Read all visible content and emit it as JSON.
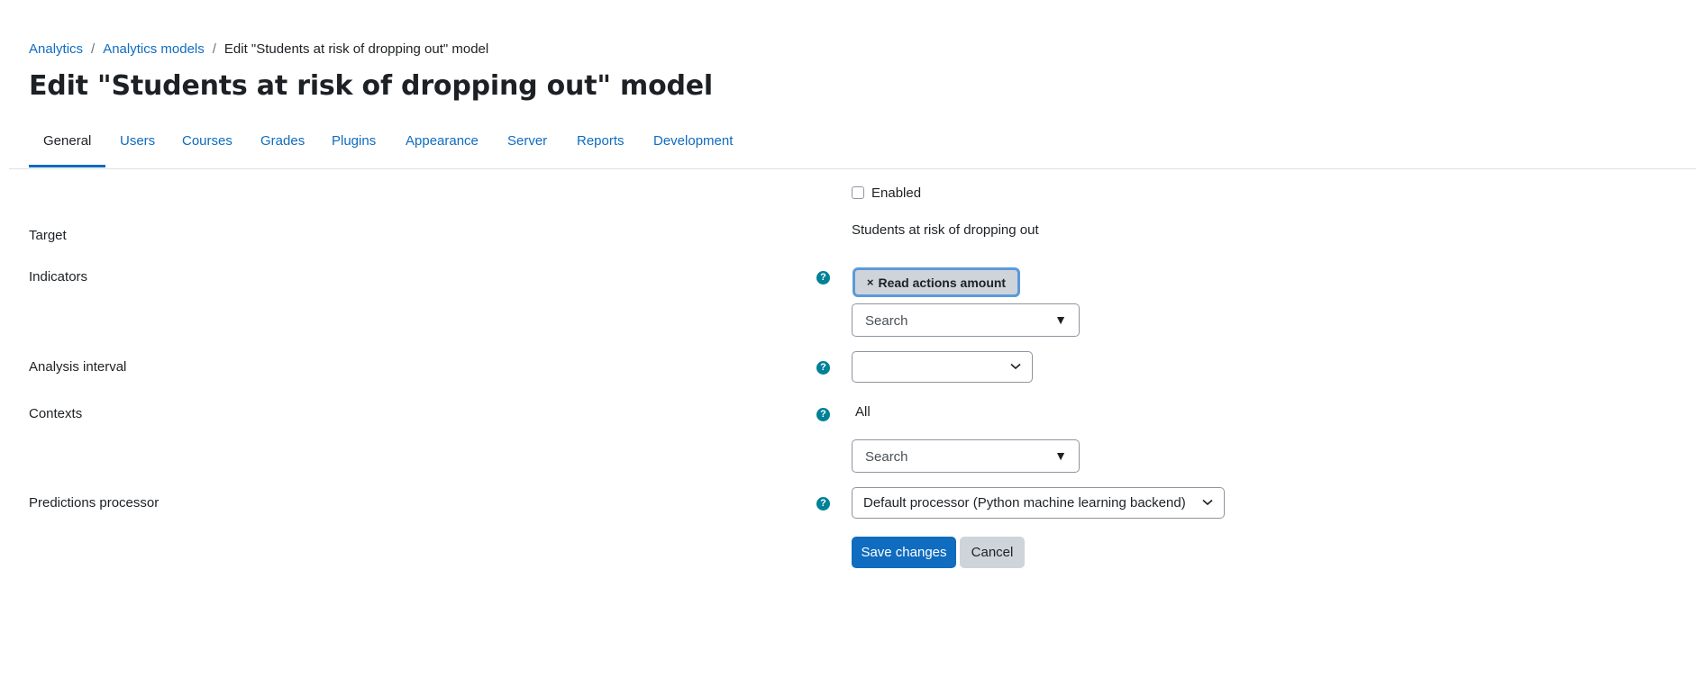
{
  "breadcrumb": {
    "items": [
      "Analytics",
      "Analytics models"
    ],
    "current": "Edit \"Students at risk of dropping out\" model"
  },
  "page": {
    "title": "Edit \"Students at risk of dropping out\" model"
  },
  "tabs": [
    {
      "label": "General",
      "active": true
    },
    {
      "label": "Users"
    },
    {
      "label": "Courses"
    },
    {
      "label": "Grades"
    },
    {
      "label": "Plugins"
    },
    {
      "label": "Appearance"
    },
    {
      "label": "Server"
    },
    {
      "label": "Reports"
    },
    {
      "label": "Development"
    }
  ],
  "form": {
    "enabled": {
      "label": "Enabled",
      "checked": false
    },
    "target": {
      "label": "Target",
      "value": "Students at risk of dropping out"
    },
    "indicators": {
      "label": "Indicators",
      "selected_tag": "Read actions amount",
      "remove_glyph": "×",
      "search_placeholder": "Search",
      "dropdown_glyph": "▼"
    },
    "analysis_interval": {
      "label": "Analysis interval",
      "value": ""
    },
    "contexts": {
      "label": "Contexts",
      "value": "All",
      "search_placeholder": "Search",
      "dropdown_glyph": "▼"
    },
    "predictions_processor": {
      "label": "Predictions processor",
      "value": "Default processor (Python machine learning backend)"
    },
    "help_glyph": "?",
    "save_label": "Save changes",
    "cancel_label": "Cancel"
  },
  "colors": {
    "link": "#0f6cbf",
    "primary_button": "#0f6cbf",
    "help_icon": "#008196",
    "tag_bg": "#ced4da",
    "tag_border": "#5b9ad8"
  },
  "icons": {
    "help": "question-circle-icon",
    "chevron": "chevron-down-icon",
    "dropdown": "caret-down-icon",
    "remove": "close-icon"
  }
}
